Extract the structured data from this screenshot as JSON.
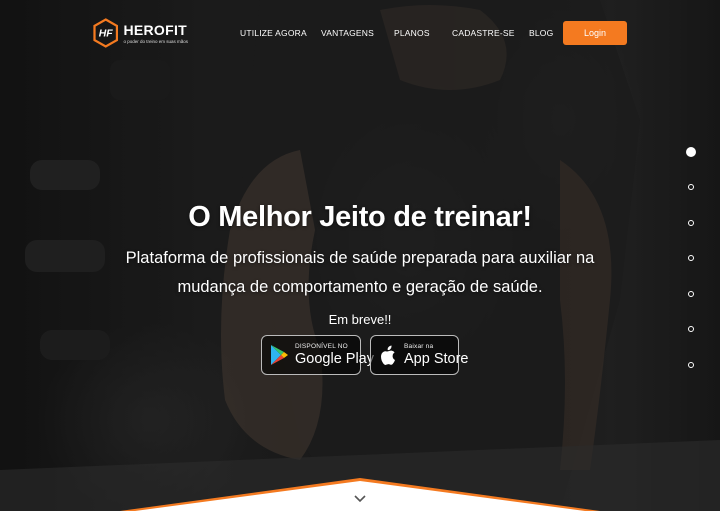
{
  "brand": {
    "monogram": "HF",
    "name": "HEROFIT",
    "tagline": "o poder do treino em suas mãos",
    "accent_color": "#f47a20"
  },
  "nav": {
    "items": [
      {
        "label": "UTILIZE AGORA"
      },
      {
        "label": "VANTAGENS"
      },
      {
        "label": "PLANOS"
      },
      {
        "label": "CADASTRE-SE"
      },
      {
        "label": "BLOG"
      }
    ],
    "login_label": "Login"
  },
  "hero": {
    "headline": "O Melhor Jeito de treinar!",
    "subtitle": "Plataforma de profissionais de saúde preparada para auxiliar na mudança de comportamento e geração de saúde.",
    "coming_soon": "Em breve!!",
    "google_play": {
      "small": "DISPONÍVEL NO",
      "big": "Google Play",
      "icon": "google-play-icon"
    },
    "app_store": {
      "small": "Baixar na",
      "big": "App Store",
      "icon": "apple-icon"
    }
  },
  "slider": {
    "count": 7,
    "active_index": 0
  },
  "scroll_icon": "chevron-down-icon"
}
